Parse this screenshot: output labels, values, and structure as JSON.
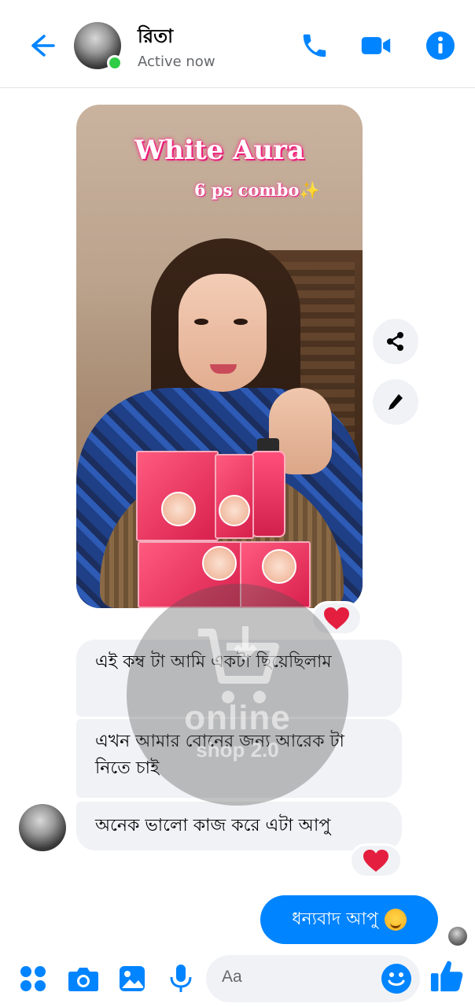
{
  "header": {
    "contact_name": "রিতা",
    "status": "Active now"
  },
  "shared_media": {
    "title": "White Aura",
    "subtitle": "6 ps combo",
    "sparkle": "✨",
    "reaction": "❤"
  },
  "messages_incoming": [
    {
      "text": "এই কম্ব টা আমি একটা ছিয়েছিলাম"
    },
    {
      "text": "এখন আমার বোনের জন্য আরেক টা নিতে চাই"
    },
    {
      "text": "অনেক ভালো কাজ করে এটা আপু",
      "reaction": "❤"
    }
  ],
  "message_outgoing": {
    "text": "ধন্যবাদ আপু"
  },
  "watermark": {
    "line1": "online",
    "line2": "shop 2.0"
  },
  "composer": {
    "placeholder": "Aa"
  },
  "colors": {
    "accent": "#0084ff",
    "online": "#31cc46",
    "heart": "#e41e3f",
    "bubble_in": "#f0f2f5"
  }
}
